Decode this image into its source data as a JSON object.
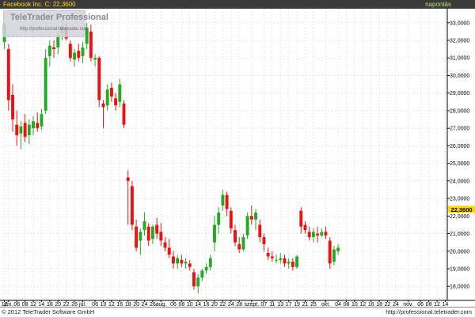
{
  "header": {
    "title": "Facebook Inc.  C: 22,3600",
    "period": "napontás"
  },
  "logo": {
    "brand": "TeleTrader Professional",
    "url": "http://professional.teletrader.com"
  },
  "footer": {
    "copyright": "© 2012 TeleTrader Software GmbH",
    "site": "http://professional.teletrader.com"
  },
  "colors": {
    "up": "#22aa22",
    "down": "#ee1111",
    "grid": "#bbbbbb",
    "axis": "#000000",
    "last_price_bg": "#ffd800"
  },
  "chart_data": {
    "type": "candlestick",
    "title": "Facebook Inc.",
    "yticks": [
      18,
      19,
      20,
      21,
      22,
      23,
      24,
      25,
      26,
      27,
      28,
      29,
      30,
      31,
      32,
      33
    ],
    "ytick_labels": [
      "18,0000",
      "19,0000",
      "20,0000",
      "21,0000",
      "22,0000",
      "23,0000",
      "24,0000",
      "25,0000",
      "26,0000",
      "27,0000",
      "28,0000",
      "29,0000",
      "30,0000",
      "31,0000",
      "32,0000",
      "33,0000"
    ],
    "ylim": [
      17.2,
      33.8
    ],
    "last_price": 22.36,
    "last_price_label": "22,3600",
    "x_labels": [
      {
        "i": 0,
        "text": "12"
      },
      {
        "i": 1,
        "text": "jún."
      },
      {
        "i": 3,
        "text": "06"
      },
      {
        "i": 5,
        "text": "08"
      },
      {
        "i": 7,
        "text": "12"
      },
      {
        "i": 9,
        "text": "14"
      },
      {
        "i": 11,
        "text": "18"
      },
      {
        "i": 13,
        "text": "20"
      },
      {
        "i": 15,
        "text": "22"
      },
      {
        "i": 17,
        "text": "26"
      },
      {
        "i": 19,
        "text": "júl."
      },
      {
        "i": 22,
        "text": "06"
      },
      {
        "i": 24,
        "text": "10"
      },
      {
        "i": 26,
        "text": "12"
      },
      {
        "i": 28,
        "text": "16"
      },
      {
        "i": 30,
        "text": "18"
      },
      {
        "i": 32,
        "text": "20"
      },
      {
        "i": 34,
        "text": "24"
      },
      {
        "i": 36,
        "text": "26"
      },
      {
        "i": 38,
        "text": "aug."
      },
      {
        "i": 41,
        "text": "06"
      },
      {
        "i": 43,
        "text": "08"
      },
      {
        "i": 45,
        "text": "10"
      },
      {
        "i": 47,
        "text": "14"
      },
      {
        "i": 49,
        "text": "16"
      },
      {
        "i": 51,
        "text": "20"
      },
      {
        "i": 53,
        "text": "22"
      },
      {
        "i": 55,
        "text": "24"
      },
      {
        "i": 57,
        "text": "28"
      },
      {
        "i": 60,
        "text": "szept."
      },
      {
        "i": 63,
        "text": "07"
      },
      {
        "i": 65,
        "text": "11"
      },
      {
        "i": 67,
        "text": "13"
      },
      {
        "i": 69,
        "text": "17"
      },
      {
        "i": 71,
        "text": "19"
      },
      {
        "i": 73,
        "text": "21"
      },
      {
        "i": 75,
        "text": "25"
      },
      {
        "i": 78,
        "text": "okt."
      },
      {
        "i": 81,
        "text": "04"
      },
      {
        "i": 83,
        "text": "08"
      },
      {
        "i": 85,
        "text": "10"
      },
      {
        "i": 87,
        "text": "12"
      },
      {
        "i": 89,
        "text": "16"
      },
      {
        "i": 91,
        "text": "18"
      },
      {
        "i": 93,
        "text": "22"
      },
      {
        "i": 95,
        "text": "24"
      },
      {
        "i": 98,
        "text": "nov."
      },
      {
        "i": 101,
        "text": "06"
      },
      {
        "i": 103,
        "text": "08"
      },
      {
        "i": 105,
        "text": "12"
      },
      {
        "i": 107,
        "text": "14"
      }
    ],
    "candles": [
      {
        "o": 31.9,
        "h": 33.0,
        "l": 31.5,
        "c": 32.9
      },
      {
        "o": 31.5,
        "h": 31.8,
        "l": 28.0,
        "c": 28.6
      },
      {
        "o": 28.9,
        "h": 29.5,
        "l": 26.8,
        "c": 27.5
      },
      {
        "o": 27.2,
        "h": 28.0,
        "l": 26.0,
        "c": 26.6
      },
      {
        "o": 26.7,
        "h": 27.4,
        "l": 25.8,
        "c": 27.1
      },
      {
        "o": 27.3,
        "h": 27.8,
        "l": 26.2,
        "c": 26.5
      },
      {
        "o": 26.6,
        "h": 27.5,
        "l": 26.1,
        "c": 27.2
      },
      {
        "o": 27.0,
        "h": 27.7,
        "l": 26.6,
        "c": 27.4
      },
      {
        "o": 27.3,
        "h": 27.9,
        "l": 26.8,
        "c": 27.0
      },
      {
        "o": 27.1,
        "h": 28.1,
        "l": 26.9,
        "c": 27.8
      },
      {
        "o": 28.0,
        "h": 31.5,
        "l": 27.8,
        "c": 31.0
      },
      {
        "o": 31.1,
        "h": 32.0,
        "l": 30.5,
        "c": 31.7
      },
      {
        "o": 31.6,
        "h": 32.0,
        "l": 31.0,
        "c": 31.5
      },
      {
        "o": 31.6,
        "h": 32.5,
        "l": 31.2,
        "c": 32.3
      },
      {
        "o": 32.4,
        "h": 33.2,
        "l": 32.0,
        "c": 32.8
      },
      {
        "o": 32.7,
        "h": 33.0,
        "l": 32.0,
        "c": 32.1
      },
      {
        "o": 31.8,
        "h": 32.0,
        "l": 30.8,
        "c": 31.0
      },
      {
        "o": 30.9,
        "h": 31.5,
        "l": 30.5,
        "c": 31.3
      },
      {
        "o": 31.4,
        "h": 31.8,
        "l": 30.8,
        "c": 31.0
      },
      {
        "o": 31.1,
        "h": 31.9,
        "l": 30.7,
        "c": 31.6
      },
      {
        "o": 31.8,
        "h": 33.0,
        "l": 31.5,
        "c": 32.7
      },
      {
        "o": 32.5,
        "h": 32.9,
        "l": 30.8,
        "c": 31.0
      },
      {
        "o": 30.9,
        "h": 31.2,
        "l": 30.5,
        "c": 31.0
      },
      {
        "o": 31.0,
        "h": 31.1,
        "l": 28.2,
        "c": 28.6
      },
      {
        "o": 28.4,
        "h": 28.6,
        "l": 27.0,
        "c": 28.2
      },
      {
        "o": 28.3,
        "h": 29.5,
        "l": 28.0,
        "c": 29.2
      },
      {
        "o": 29.3,
        "h": 29.6,
        "l": 28.5,
        "c": 28.8
      },
      {
        "o": 28.7,
        "h": 29.0,
        "l": 28.0,
        "c": 28.3
      },
      {
        "o": 28.5,
        "h": 29.8,
        "l": 28.2,
        "c": 29.5
      },
      {
        "o": 28.4,
        "h": 28.6,
        "l": 27.0,
        "c": 27.2
      },
      {
        "o": 24.2,
        "h": 24.6,
        "l": 21.5,
        "c": 24.0
      },
      {
        "o": 23.7,
        "h": 24.0,
        "l": 21.2,
        "c": 21.5
      },
      {
        "o": 21.4,
        "h": 21.8,
        "l": 20.0,
        "c": 20.2
      },
      {
        "o": 20.6,
        "h": 21.3,
        "l": 19.8,
        "c": 21.1
      },
      {
        "o": 21.2,
        "h": 22.2,
        "l": 20.9,
        "c": 21.7
      },
      {
        "o": 21.4,
        "h": 21.6,
        "l": 20.3,
        "c": 20.6
      },
      {
        "o": 20.7,
        "h": 21.5,
        "l": 20.4,
        "c": 21.4
      },
      {
        "o": 21.5,
        "h": 21.9,
        "l": 20.7,
        "c": 21.0
      },
      {
        "o": 21.1,
        "h": 21.6,
        "l": 20.3,
        "c": 20.6
      },
      {
        "o": 20.5,
        "h": 20.8,
        "l": 20.0,
        "c": 20.2
      },
      {
        "o": 20.2,
        "h": 20.7,
        "l": 19.6,
        "c": 19.8
      },
      {
        "o": 19.7,
        "h": 20.0,
        "l": 19.0,
        "c": 19.3
      },
      {
        "o": 19.3,
        "h": 19.8,
        "l": 19.0,
        "c": 19.6
      },
      {
        "o": 19.5,
        "h": 19.8,
        "l": 19.1,
        "c": 19.3
      },
      {
        "o": 19.3,
        "h": 19.6,
        "l": 19.0,
        "c": 19.4
      },
      {
        "o": 19.3,
        "h": 19.5,
        "l": 18.9,
        "c": 19.1
      },
      {
        "o": 18.8,
        "h": 19.0,
        "l": 17.8,
        "c": 18.0
      },
      {
        "o": 18.0,
        "h": 18.7,
        "l": 17.6,
        "c": 18.5
      },
      {
        "o": 18.5,
        "h": 19.0,
        "l": 18.3,
        "c": 18.9
      },
      {
        "o": 18.9,
        "h": 19.3,
        "l": 18.7,
        "c": 19.1
      },
      {
        "o": 19.1,
        "h": 19.8,
        "l": 18.9,
        "c": 19.6
      },
      {
        "o": 20.5,
        "h": 22.0,
        "l": 20.0,
        "c": 21.5
      },
      {
        "o": 21.5,
        "h": 22.5,
        "l": 21.0,
        "c": 22.2
      },
      {
        "o": 22.6,
        "h": 23.5,
        "l": 22.3,
        "c": 23.2
      },
      {
        "o": 23.2,
        "h": 23.4,
        "l": 22.0,
        "c": 22.4
      },
      {
        "o": 22.3,
        "h": 22.5,
        "l": 21.0,
        "c": 21.3
      },
      {
        "o": 21.2,
        "h": 21.5,
        "l": 20.3,
        "c": 20.5
      },
      {
        "o": 20.4,
        "h": 20.8,
        "l": 19.9,
        "c": 20.1
      },
      {
        "o": 20.1,
        "h": 21.0,
        "l": 20.0,
        "c": 20.8
      },
      {
        "o": 20.9,
        "h": 22.2,
        "l": 20.7,
        "c": 22.0
      },
      {
        "o": 22.0,
        "h": 22.6,
        "l": 21.5,
        "c": 21.8
      },
      {
        "o": 21.8,
        "h": 22.4,
        "l": 21.2,
        "c": 22.2
      },
      {
        "o": 21.5,
        "h": 21.8,
        "l": 20.5,
        "c": 20.8
      },
      {
        "o": 20.8,
        "h": 21.0,
        "l": 20.0,
        "c": 20.4
      },
      {
        "o": 19.9,
        "h": 20.2,
        "l": 19.5,
        "c": 19.7
      },
      {
        "o": 19.7,
        "h": 20.0,
        "l": 19.4,
        "c": 19.6
      },
      {
        "o": 19.5,
        "h": 19.8,
        "l": 19.3,
        "c": 19.5
      },
      {
        "o": 19.5,
        "h": 19.9,
        "l": 19.3,
        "c": 19.6
      },
      {
        "o": 19.6,
        "h": 19.8,
        "l": 19.1,
        "c": 19.3
      },
      {
        "o": 19.3,
        "h": 19.6,
        "l": 19.0,
        "c": 19.4
      },
      {
        "o": 19.4,
        "h": 19.6,
        "l": 18.9,
        "c": 19.1
      },
      {
        "o": 19.1,
        "h": 19.8,
        "l": 19.0,
        "c": 19.7
      },
      {
        "o": 22.3,
        "h": 22.5,
        "l": 21.0,
        "c": 21.4
      },
      {
        "o": 21.5,
        "h": 21.7,
        "l": 21.0,
        "c": 21.2
      },
      {
        "o": 21.1,
        "h": 21.4,
        "l": 20.6,
        "c": 20.8
      },
      {
        "o": 20.8,
        "h": 21.3,
        "l": 20.5,
        "c": 21.1
      },
      {
        "o": 21.0,
        "h": 21.4,
        "l": 20.5,
        "c": 20.9
      },
      {
        "o": 20.9,
        "h": 21.3,
        "l": 20.8,
        "c": 21.1
      },
      {
        "o": 21.1,
        "h": 21.4,
        "l": 20.7,
        "c": 20.9
      },
      {
        "o": 20.6,
        "h": 20.8,
        "l": 19.0,
        "c": 19.3
      },
      {
        "o": 19.4,
        "h": 20.3,
        "l": 19.2,
        "c": 20.1
      },
      {
        "o": 20.0,
        "h": 20.4,
        "l": 19.8,
        "c": 20.2
      }
    ]
  }
}
